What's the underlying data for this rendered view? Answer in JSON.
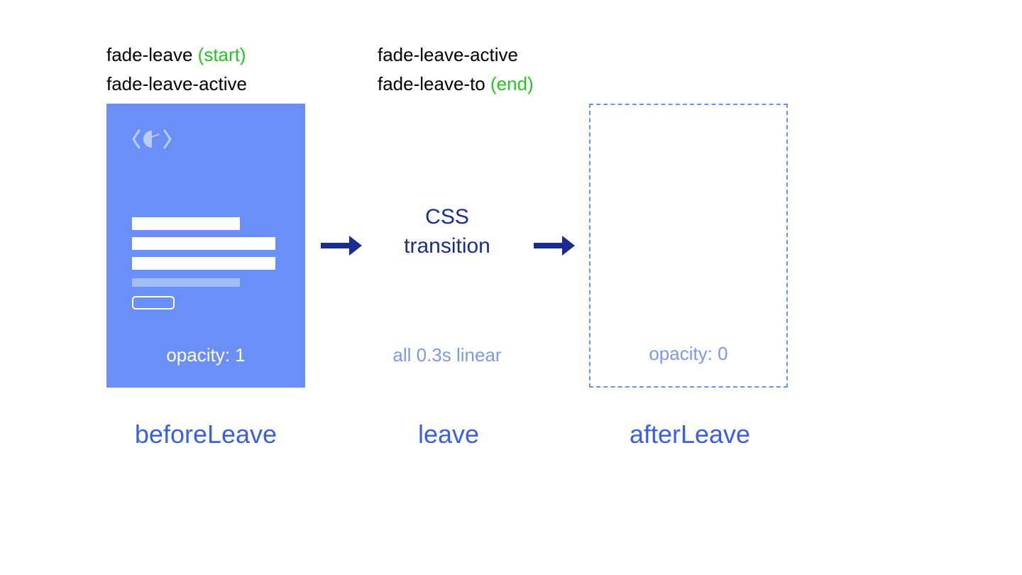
{
  "labels": {
    "col1": {
      "line1_prefix": "fade-leave ",
      "line1_suffix": "(start)",
      "line2": "fade-leave-active"
    },
    "col2": {
      "line1": "fade-leave-active",
      "line2_prefix": "fade-leave-to ",
      "line2_suffix": "(end)"
    }
  },
  "stage1": {
    "opacity": "opacity: 1"
  },
  "center": {
    "title_line1": "CSS",
    "title_line2": "transition",
    "timing": "all 0.3s linear"
  },
  "stage3": {
    "opacity": "opacity: 0"
  },
  "hooks": {
    "before": "beforeLeave",
    "during": "leave",
    "after": "afterLeave"
  }
}
